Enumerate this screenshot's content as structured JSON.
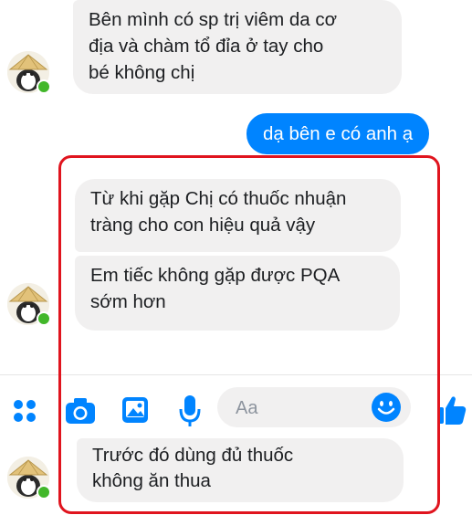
{
  "conversation": {
    "messages": [
      {
        "direction": "incoming",
        "text": "Bên mình có sp trị viêm da cơ\nđịa và chàm tổ đỉa ở tay cho\nbé không chị"
      },
      {
        "direction": "outgoing",
        "text": "dạ bên e có anh ạ"
      },
      {
        "direction": "incoming",
        "text": "Từ khi gặp Chị có thuốc nhuận\ntràng cho con hiệu quả vậy"
      },
      {
        "direction": "incoming",
        "text": "Em tiếc không gặp được PQA\nsớm hơn"
      },
      {
        "direction": "incoming",
        "text": "Trước đó dùng đủ thuốc\nkhông ăn thua"
      }
    ]
  },
  "composer": {
    "placeholder": "Aa",
    "icons": [
      "apps-icon",
      "camera-icon",
      "gallery-icon",
      "microphone-icon",
      "emoji-icon",
      "thumbs-up-icon"
    ]
  },
  "colors": {
    "accent": "#0084ff",
    "incoming_bubble": "#f1f0f0",
    "online": "#42b72a",
    "highlight_frame": "#e0141e"
  }
}
